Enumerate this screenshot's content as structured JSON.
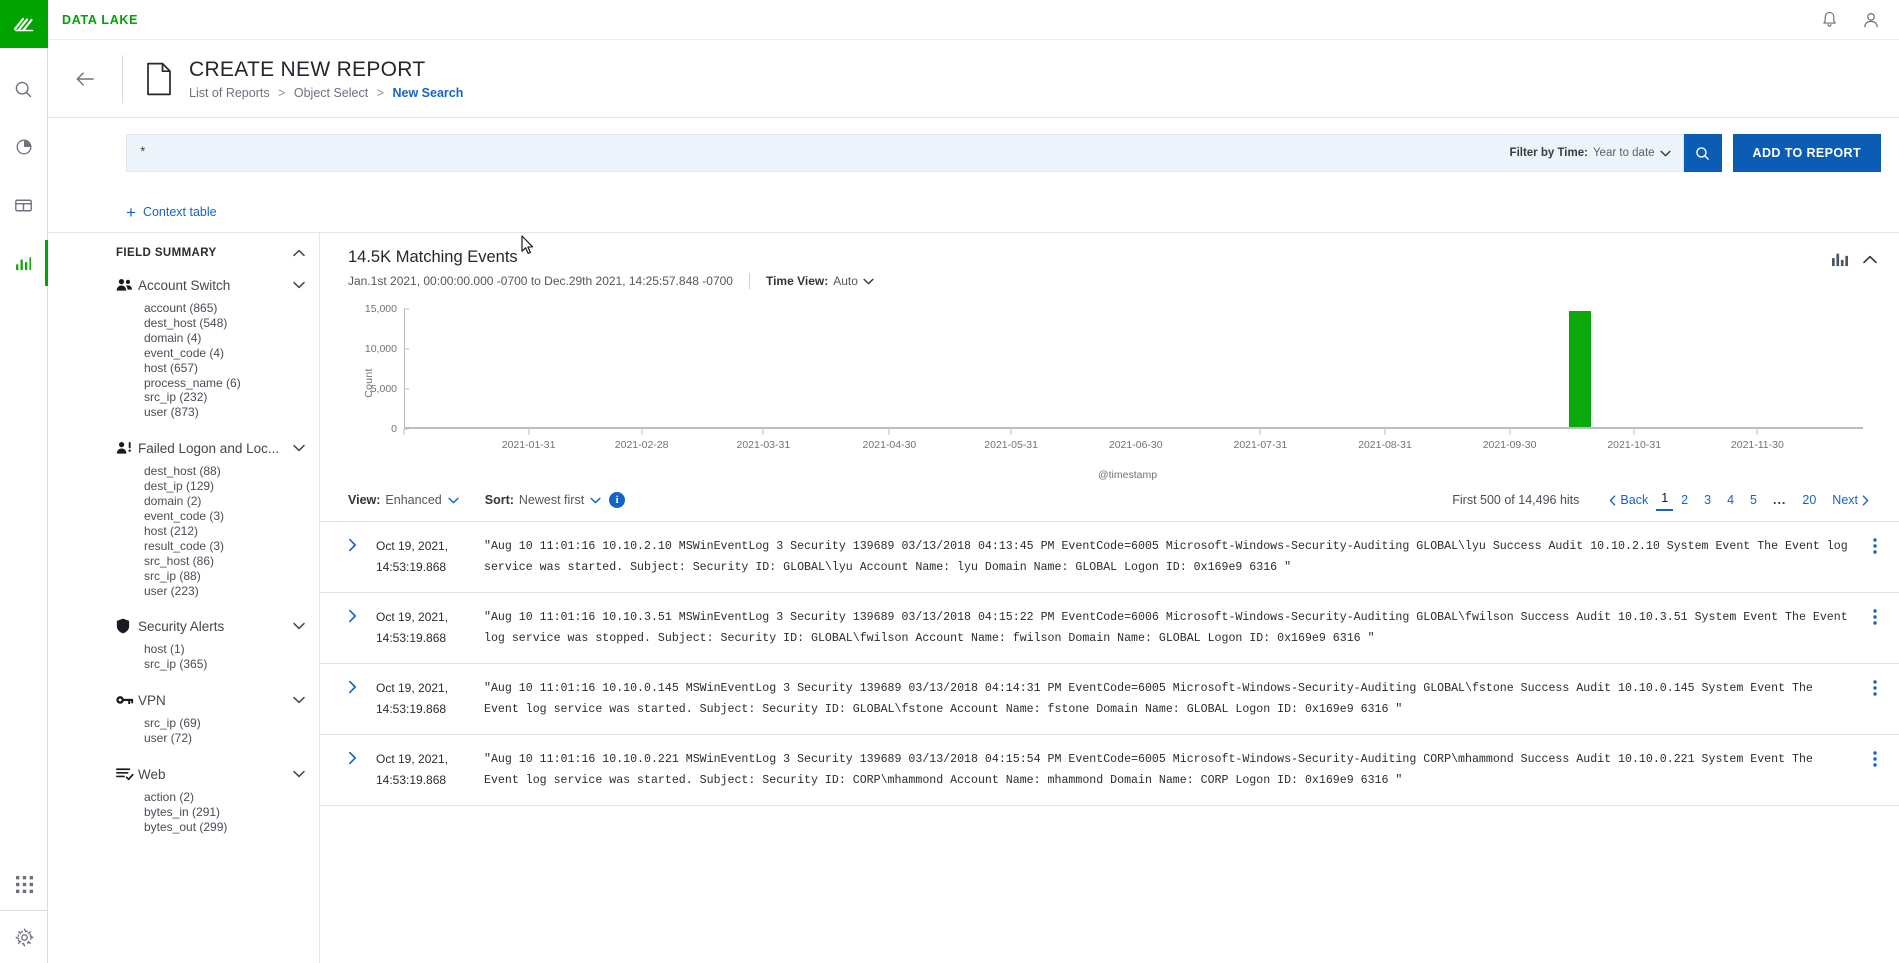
{
  "brand": "DATA LAKE",
  "rail": {
    "logo_icon": "data-lake-logo",
    "items": [
      {
        "name": "search",
        "icon": "search-icon",
        "active": false
      },
      {
        "name": "analytics",
        "icon": "pie-chart-icon",
        "active": false
      },
      {
        "name": "dashboards",
        "icon": "layout-panel-icon",
        "active": false
      },
      {
        "name": "reports",
        "icon": "bar-chart-icon",
        "active": true
      }
    ],
    "bottom": [
      {
        "name": "apps",
        "icon": "grid-apps-icon"
      },
      {
        "name": "settings",
        "icon": "gear-icon"
      }
    ]
  },
  "topbar": {
    "notifications_icon": "bell-icon",
    "account_icon": "user-avatar-icon"
  },
  "header": {
    "back_icon": "arrow-left-icon",
    "doc_icon": "document-icon",
    "title": "CREATE NEW REPORT",
    "breadcrumbs": [
      {
        "label": "List of Reports",
        "current": false
      },
      {
        "label": "Object Select",
        "current": false
      },
      {
        "label": "New Search",
        "current": true
      }
    ],
    "separator": ">"
  },
  "search": {
    "query": "*",
    "placeholder": "*",
    "filter_label": "Filter by Time:",
    "filter_value": "Year to date",
    "search_icon": "magnifier-icon",
    "add_to_report_label": "ADD TO REPORT",
    "context_table_label": "Context table",
    "context_plus": "+"
  },
  "field_summary": {
    "title": "FIELD SUMMARY",
    "groups": [
      {
        "name": "Account Switch",
        "icon": "two-people-icon",
        "fields": [
          "account (865)",
          "dest_host (548)",
          "domain (4)",
          "event_code (4)",
          "host (657)",
          "process_name (6)",
          "src_ip (232)",
          "user (873)"
        ]
      },
      {
        "name": "Failed Logon and Loc...",
        "icon": "person-alert-icon",
        "fields": [
          "dest_host (88)",
          "dest_ip (129)",
          "domain (2)",
          "event_code (3)",
          "host (212)",
          "result_code (3)",
          "src_host (86)",
          "src_ip (88)",
          "user (223)"
        ]
      },
      {
        "name": "Security Alerts",
        "icon": "shield-icon",
        "fields": [
          "host (1)",
          "src_ip (365)"
        ]
      },
      {
        "name": "VPN",
        "icon": "key-icon",
        "fields": [
          "src_ip (69)",
          "user (72)"
        ]
      },
      {
        "name": "Web",
        "icon": "list-check-icon",
        "fields": [
          "action (2)",
          "bytes_in (291)",
          "bytes_out (299)"
        ]
      }
    ]
  },
  "results": {
    "count_label": "14.5K Matching Events",
    "time_range": "Jan.1st 2021, 00:00:00.000 -0700 to Dec.29th 2021, 14:25:57.848 -0700",
    "time_view_label": "Time View:",
    "time_view_value": "Auto",
    "chart_toggle_icon": "bar-chart-icon",
    "collapse_icon": "chevron-up-icon",
    "view_label": "View:",
    "view_value": "Enhanced",
    "sort_label": "Sort:",
    "sort_value": "Newest first",
    "info_badge": "i",
    "hits_label": "First 500 of 14,496 hits",
    "pager": {
      "back": "Back",
      "pages": [
        "1",
        "2",
        "3",
        "4",
        "5"
      ],
      "ellipsis": "...",
      "last": "20",
      "next": "Next",
      "current": "1"
    }
  },
  "chart_data": {
    "type": "bar",
    "title": "14.5K Matching Events",
    "xlabel": "@timestamp",
    "ylabel": "Count",
    "ylim": [
      0,
      15000
    ],
    "yticks": [
      0,
      5000,
      10000,
      15000
    ],
    "ytick_labels": [
      "0",
      "5,000",
      "10,000",
      "15,000"
    ],
    "xtick_labels": [
      "2021-01-31",
      "2021-02-28",
      "2021-03-31",
      "2021-04-30",
      "2021-05-31",
      "2021-06-30",
      "2021-07-31",
      "2021-08-31",
      "2021-09-30",
      "2021-10-31",
      "2021-11-30"
    ],
    "categories": [
      "2021-01-31",
      "2021-02-28",
      "2021-03-31",
      "2021-04-30",
      "2021-05-31",
      "2021-06-30",
      "2021-07-31",
      "2021-08-31",
      "2021-09-30",
      "2021-10-31",
      "2021-11-30"
    ],
    "values": [
      0,
      0,
      0,
      0,
      0,
      0,
      0,
      0,
      0,
      14496,
      0
    ],
    "bar_color": "#0ba80b",
    "grid": false,
    "legend": false
  },
  "events": [
    {
      "timestamp_date": "Oct 19, 2021,",
      "timestamp_time": "14:53:19.868",
      "raw": "\"Aug 10 11:01:16 10.10.2.10 MSWinEventLog 3 Security 139689 03/13/2018 04:13:45 PM EventCode=6005 Microsoft-Windows-Security-Auditing GLOBAL\\lyu Success Audit 10.10.2.10 System Event The Event log service was started. Subject: Security ID: GLOBAL\\lyu Account Name: lyu Domain Name: GLOBAL Logon ID: 0x169e9 6316 \""
    },
    {
      "timestamp_date": "Oct 19, 2021,",
      "timestamp_time": "14:53:19.868",
      "raw": "\"Aug 10 11:01:16 10.10.3.51 MSWinEventLog 3 Security 139689 03/13/2018 04:15:22 PM EventCode=6006 Microsoft-Windows-Security-Auditing GLOBAL\\fwilson Success Audit 10.10.3.51 System Event The Event log service was stopped. Subject: Security ID: GLOBAL\\fwilson Account Name: fwilson Domain Name: GLOBAL Logon ID: 0x169e9 6316 \""
    },
    {
      "timestamp_date": "Oct 19, 2021,",
      "timestamp_time": "14:53:19.868",
      "raw": "\"Aug 10 11:01:16 10.10.0.145 MSWinEventLog 3 Security 139689 03/13/2018 04:14:31 PM EventCode=6005 Microsoft-Windows-Security-Auditing GLOBAL\\fstone Success Audit 10.10.0.145 System Event The Event log service was started. Subject: Security ID: GLOBAL\\fstone Account Name: fstone Domain Name: GLOBAL Logon ID: 0x169e9 6316 \""
    },
    {
      "timestamp_date": "Oct 19, 2021,",
      "timestamp_time": "14:53:19.868",
      "raw": "\"Aug 10 11:01:16 10.10.0.221 MSWinEventLog 3 Security 139689 03/13/2018 04:15:54 PM EventCode=6005 Microsoft-Windows-Security-Auditing CORP\\mhammond Success Audit 10.10.0.221 System Event The Event log service was started. Subject: Security ID: CORP\\mhammond Account Name: mhammond Domain Name: CORP Logon ID: 0x169e9 6316 \""
    }
  ],
  "colors": {
    "brand_green": "#00a300",
    "accent_blue": "#1464c8",
    "button_blue": "#0b5cb5",
    "bar_green": "#0ba80b"
  }
}
